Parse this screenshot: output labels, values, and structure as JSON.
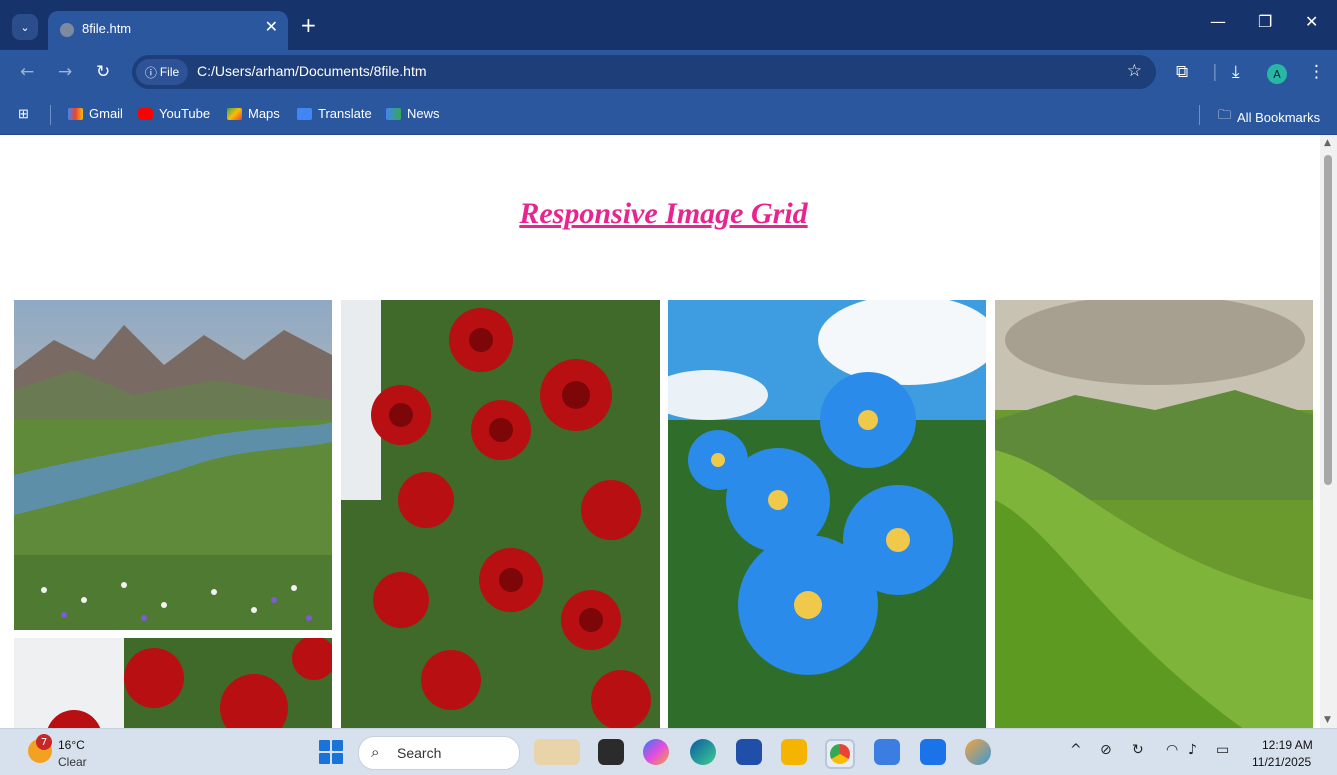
{
  "browser": {
    "tab_title": "8file.htm",
    "chip_label": "File",
    "url": "C:/Users/arham/Documents/8file.htm",
    "profile_initial": "A",
    "bookmarks": [
      {
        "label": "Gmail"
      },
      {
        "label": "YouTube"
      },
      {
        "label": "Maps"
      },
      {
        "label": "Translate"
      },
      {
        "label": "News"
      }
    ],
    "all_bookmarks": "All Bookmarks"
  },
  "page": {
    "heading": "Responsive Image Grid",
    "heading_color": "#e8258e",
    "images": [
      {
        "subject": "mountain-valley-river"
      },
      {
        "subject": "red-roses"
      },
      {
        "subject": "blue-flowers"
      },
      {
        "subject": "green-hills"
      },
      {
        "subject": "red-roses"
      }
    ]
  },
  "taskbar": {
    "weather_temp": "16°C",
    "weather_cond": "Clear",
    "weather_badge": "7",
    "search_placeholder": "Search",
    "time": "12:19 AM",
    "date": "11/21/2025"
  }
}
